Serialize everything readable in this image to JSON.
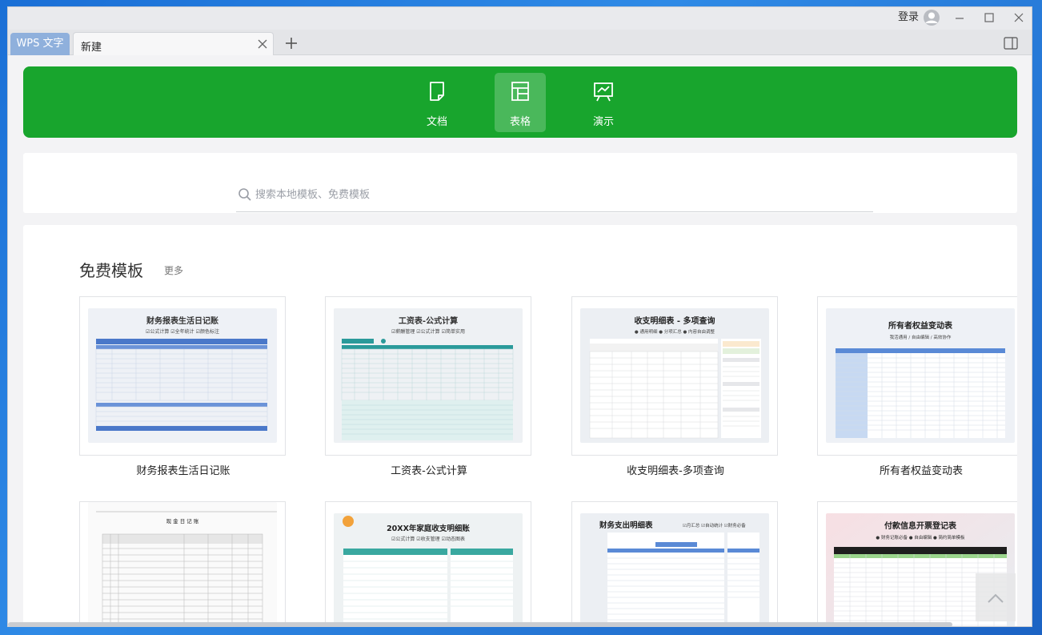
{
  "window": {
    "login_label": "登录"
  },
  "tabs": {
    "app_tab": "WPS 文字",
    "doc_tab": "新建"
  },
  "categories": [
    {
      "label": "文档",
      "icon": "document-icon",
      "active": false
    },
    {
      "label": "表格",
      "icon": "table-icon",
      "active": true
    },
    {
      "label": "演示",
      "icon": "presentation-icon",
      "active": false
    }
  ],
  "search": {
    "placeholder": "搜索本地模板、免费模板"
  },
  "templates_section": {
    "title": "免费模板",
    "more_label": "更多",
    "row1": [
      {
        "caption": "财务报表生活日记账",
        "thumb_title": "财务报表生活日记账",
        "thumb_sub": "☑公式计算  ☑全年统计  ☑颜色标注",
        "accent": "#4a78c9"
      },
      {
        "caption": "工资表-公式计算",
        "thumb_title": "工资表-公式计算",
        "thumb_sub": "☑薪酬管理  ☑公式计算  ☑简单实用",
        "accent": "#2a9a9a"
      },
      {
        "caption": "收支明细表-多项查询",
        "thumb_title": "收支明细表 - 多项查询",
        "thumb_sub": "● 通用明细  ● 分项汇总  ● 内容自由调整",
        "accent": "#333333"
      },
      {
        "caption": "所有者权益变动表",
        "thumb_title": "所有者权益变动表",
        "thumb_sub": "我活通用 / 自由编辑 / 高效协作",
        "accent": "#5a8ad6"
      }
    ],
    "row2": [
      {
        "thumb_title": "现 金 日 记 账",
        "accent": "#888888"
      },
      {
        "thumb_title": "20XX年家庭收支明细账",
        "thumb_sub": "☑公式计算 ☑收支管理 ☑动态图表",
        "accent": "#3aa8a0"
      },
      {
        "thumb_title": "财务支出明细表",
        "thumb_sub": "☑月汇总 ☑自动统计 ☑财务必备",
        "accent": "#5a8ad6"
      },
      {
        "thumb_title": "付款信息开票登记表",
        "thumb_sub": "● 财务记账必备  ● 自由编辑  ● 简约简单模板",
        "accent": "#2a2a2a"
      }
    ]
  },
  "colors": {
    "brand_green": "#18a52d",
    "app_tab_blue": "#8fb0dc"
  }
}
